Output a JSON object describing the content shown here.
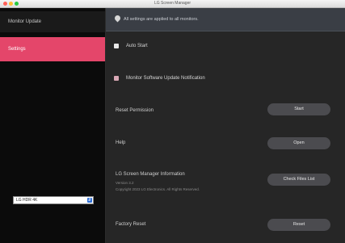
{
  "window": {
    "title": "LG Screen Manager"
  },
  "sidebar": {
    "items": [
      {
        "label": "Monitor Update"
      },
      {
        "label": "Settings"
      }
    ],
    "display_select": {
      "value": "LG HDR 4K"
    }
  },
  "main": {
    "banner_text": "All settings are applied to all monitors.",
    "auto_start": {
      "label": "Auto Start"
    },
    "monitor_update_notification": {
      "label": "Monitor Software Update Notification"
    },
    "rows": [
      {
        "label": "Reset Permission",
        "button": "Start"
      },
      {
        "label": "Help",
        "button": "Open"
      },
      {
        "label": "LG Screen Manager Information",
        "button": "Check Files List",
        "sub1": "Version 3.2",
        "sub2": "Copyright 2023 LG Electronics. All Rights Reserved."
      },
      {
        "label": "Factory Reset",
        "button": "Reset"
      }
    ]
  },
  "colors": {
    "accent": "#e4466a",
    "sidebar_bg": "#0b0b0b",
    "main_bg": "#262626",
    "banner_bg": "#3a3e45",
    "button_bg": "#4b4b4f"
  },
  "icons": {
    "banner": "location-pin-icon"
  }
}
